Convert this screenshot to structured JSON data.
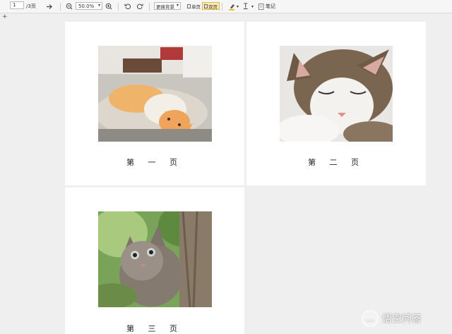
{
  "toolbar": {
    "page_input": "1",
    "page_total": "/3页",
    "zoom": "50.0%",
    "bg_label": "更换背景",
    "single_label": "单页",
    "double_label": "双页",
    "text_tool": "T",
    "note_label": "笔记"
  },
  "plus": "+",
  "pages": {
    "p1": "第 一 页",
    "p2": "第 二 页",
    "p3": "第 三 页"
  },
  "watermark": {
    "text": "悟空问答"
  },
  "colors": {
    "background": "#efefef",
    "page": "#ffffff",
    "active_mode": "#fde9b3"
  },
  "icons": [
    "next-page-arrow-icon",
    "zoom-out-icon",
    "zoom-in-icon",
    "rotate-left-icon",
    "rotate-right-icon",
    "highlighter-icon",
    "note-icon"
  ]
}
